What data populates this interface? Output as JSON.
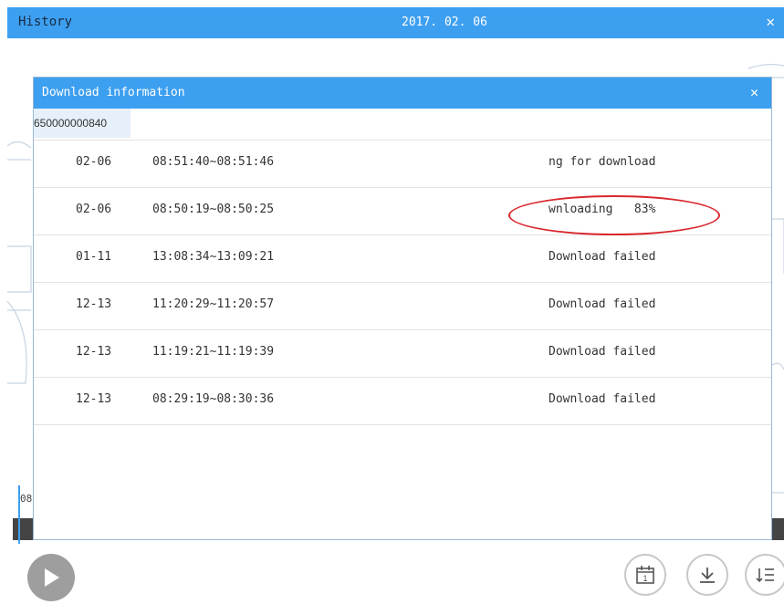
{
  "window": {
    "title": "History",
    "date": "2017. 02. 06",
    "close_icon": "close-icon"
  },
  "timeline": {
    "label": "08"
  },
  "dialog": {
    "title": "Download information",
    "device_id": "650000000840",
    "rows": [
      {
        "date": "02-06",
        "time": "08:51:40~08:51:46",
        "status": "ng for download"
      },
      {
        "date": "02-06",
        "time": "08:50:19~08:50:25",
        "status": "wnloading   83%"
      },
      {
        "date": "01-11",
        "time": "13:08:34~13:09:21",
        "status": "Download failed"
      },
      {
        "date": "12-13",
        "time": "11:20:29~11:20:57",
        "status": "Download failed"
      },
      {
        "date": "12-13",
        "time": "11:19:21~11:19:39",
        "status": "Download failed"
      },
      {
        "date": "12-13",
        "time": "08:29:19~08:30:36",
        "status": "Download failed"
      }
    ],
    "highlight_color": "#d9272e"
  },
  "toolbar": {
    "icons": [
      "play-icon",
      "calendar-icon",
      "download-icon",
      "list-icon"
    ],
    "calendar_day": "1"
  },
  "colors": {
    "accent": "#3d9ff0",
    "timeline": "#444444"
  }
}
